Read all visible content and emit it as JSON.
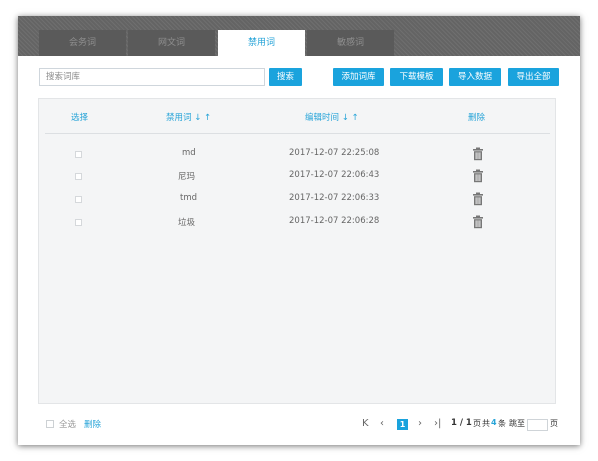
{
  "tabs": [
    {
      "label": "会务词",
      "active": false
    },
    {
      "label": "网文词",
      "active": false
    },
    {
      "label": "禁用词",
      "active": true
    },
    {
      "label": "敏感词",
      "active": false
    }
  ],
  "toolbar": {
    "search_placeholder": "搜索词库",
    "search_value": "",
    "search_label": "搜索",
    "add_label": "添加词库",
    "download_label": "下载模板",
    "import_label": "导入数据",
    "export_label": "导出全部"
  },
  "table": {
    "headers": {
      "select": "选择",
      "word": "禁用词 ↓ ↑",
      "time": "编辑时间 ↓ ↑",
      "delete": "删除"
    },
    "rows": [
      {
        "word": "md",
        "time": "2017-12-07 22:25:08"
      },
      {
        "word": "尼玛",
        "time": "2017-12-07 22:06:43"
      },
      {
        "word": "tmd",
        "time": "2017-12-07 22:06:33"
      },
      {
        "word": "垃圾",
        "time": "2017-12-07 22:06:28"
      }
    ]
  },
  "footer": {
    "select_all": "全选",
    "delete": "删除",
    "first_icon": "K",
    "prev_icon": "‹",
    "current_page": "1",
    "next_icon": "›",
    "last_icon": "›|",
    "page_info": "1 / 1",
    "page_unit": "页",
    "total_prefix": "共",
    "total_count": "4",
    "total_suffix": "条",
    "jump_label": "跳至",
    "jump_value": "",
    "jump_suffix": "页"
  },
  "colors": {
    "accent": "#1aa3dd",
    "tab_bar": "#666666",
    "panel_bg": "#f4f5f6"
  }
}
